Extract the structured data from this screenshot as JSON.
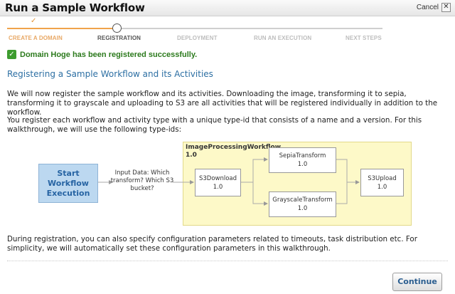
{
  "window": {
    "title": "Run a Sample Workflow",
    "cancel_label": "Cancel",
    "close_glyph": "✕"
  },
  "steps": [
    {
      "label": "CREATE A DOMAIN",
      "state": "done"
    },
    {
      "label": "REGISTRATION",
      "state": "current"
    },
    {
      "label": "DEPLOYMENT",
      "state": "upcoming"
    },
    {
      "label": "RUN AN EXECUTION",
      "state": "upcoming"
    },
    {
      "label": "NEXT STEPS",
      "state": "upcoming"
    }
  ],
  "success_message": "Domain Hoge has been registered successfully.",
  "section_title": "Registering a Sample Workflow and its Activities",
  "paragraphs": {
    "intro": "We will now register the sample workflow and its activities. Downloading the image, transforming it to sepia, transforming it to grayscale and uploading to S3 are all activities that will be registered individually in addition to the workflow.",
    "type_ids": "You register each workflow and activity type with a unique type-id that consists of a name and a version. For this walkthrough, we will use the following type-ids:",
    "config": "During registration, you can also specify configuration parameters related to timeouts, task distribution etc. For simplicity, we will automatically set these configuration parameters in this walkthrough."
  },
  "diagram": {
    "start_label": "Start Workflow Execution",
    "input_label": "Input Data: Which transform? Which S3 bucket?",
    "workflow": {
      "name": "ImageProcessingWorkflow",
      "version": "1.0"
    },
    "activities": {
      "s3download": {
        "name": "S3Download",
        "version": "1.0"
      },
      "sepia": {
        "name": "SepiaTransform",
        "version": "1.0"
      },
      "grayscale": {
        "name": "GrayscaleTransform",
        "version": "1.0"
      },
      "s3upload": {
        "name": "S3Upload",
        "version": "1.0"
      }
    }
  },
  "buttons": {
    "continue_label": "Continue"
  },
  "colors": {
    "accent": "#2d6fa3",
    "step_done": "#f0a34b",
    "success": "#2c7a1d",
    "workflow_bg": "#fdf9c8",
    "start_bg": "#bcd8f0"
  }
}
